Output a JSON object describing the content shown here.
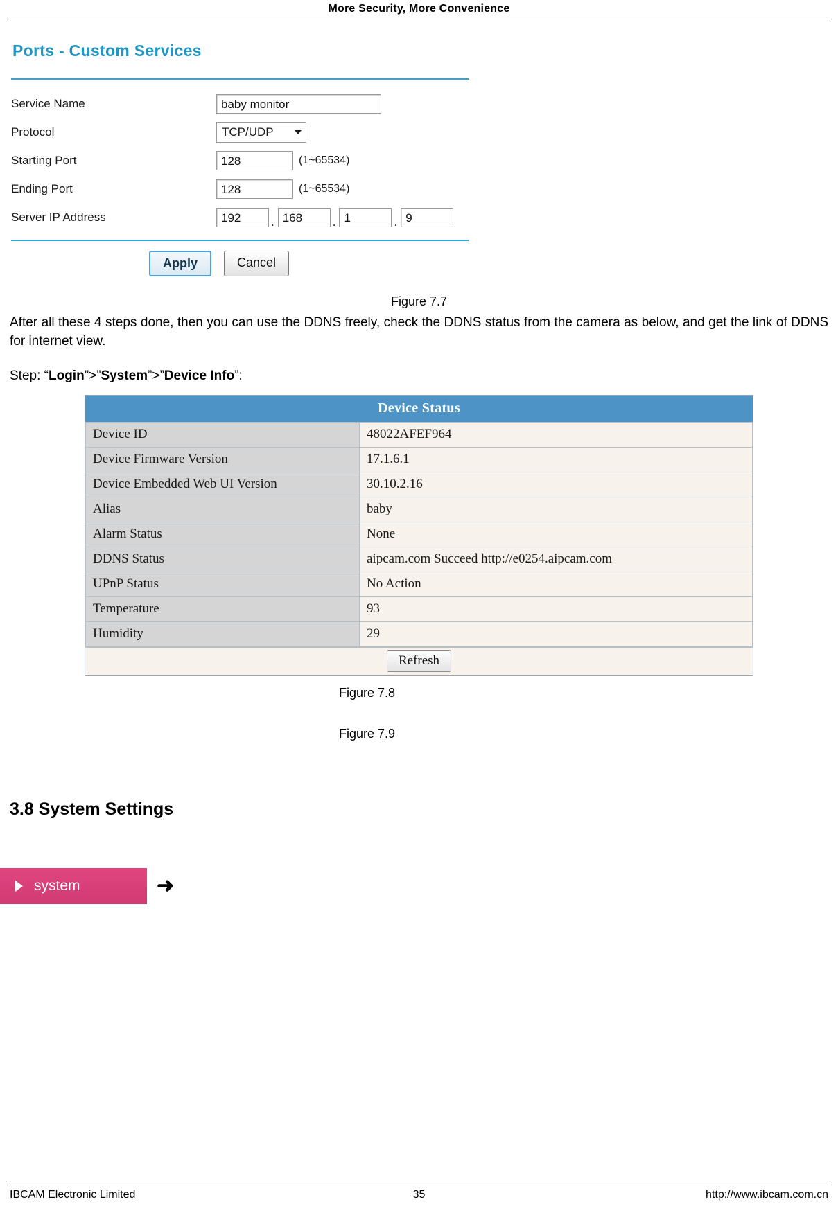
{
  "header": {
    "title": "More Security, More Convenience"
  },
  "ports_panel": {
    "title": "Ports - Custom Services",
    "rows": {
      "service_name_label": "Service Name",
      "service_name_value": "baby monitor",
      "protocol_label": "Protocol",
      "protocol_value": "TCP/UDP",
      "starting_port_label": "Starting Port",
      "starting_port_value": "128",
      "starting_port_hint": "(1~65534)",
      "ending_port_label": "Ending Port",
      "ending_port_value": "128",
      "ending_port_hint": "(1~65534)",
      "server_ip_label": "Server IP Address",
      "server_ip_octets": [
        "192",
        "168",
        "1",
        "9"
      ],
      "ip_separator": "."
    },
    "apply_label": "Apply",
    "cancel_label": "Cancel"
  },
  "figures": {
    "fig77": "Figure 7.7",
    "fig78": "Figure 7.8",
    "fig79": "Figure 7.9"
  },
  "body": {
    "paragraph": "After all these 4 steps done, then you can use the DDNS freely, check the DDNS status from the camera as below, and get the link of DDNS for internet view.",
    "step_prefix": "Step: “",
    "step_login": "Login",
    "step_sep1": "”>”",
    "step_system": "System",
    "step_sep2": "”>”",
    "step_deviceinfo": "Device Info",
    "step_suffix": "”:"
  },
  "device_status": {
    "title": "Device Status",
    "rows": [
      {
        "key": "Device ID",
        "value": "48022AFEF964"
      },
      {
        "key": "Device Firmware Version",
        "value": "17.1.6.1"
      },
      {
        "key": "Device Embedded Web UI Version",
        "value": "30.10.2.16"
      },
      {
        "key": "Alias",
        "value": "baby"
      },
      {
        "key": "Alarm Status",
        "value": "None"
      },
      {
        "key": "DDNS Status",
        "value": "aipcam.com  Succeed  http://e0254.aipcam.com"
      },
      {
        "key": "UPnP Status",
        "value": "No Action"
      },
      {
        "key": "Temperature",
        "value": "93"
      },
      {
        "key": "Humidity",
        "value": "29"
      }
    ],
    "refresh_label": "Refresh"
  },
  "section": {
    "heading": "3.8 System Settings",
    "system_button_label": "system",
    "arrow_glyph": "➜"
  },
  "footer": {
    "left": "IBCAM Electronic Limited",
    "center": "35",
    "right": "http://www.ibcam.com.cn"
  },
  "colors": {
    "accent_blue": "#2196c4",
    "table_header": "#4e93c6",
    "system_pink": "#d94081"
  }
}
